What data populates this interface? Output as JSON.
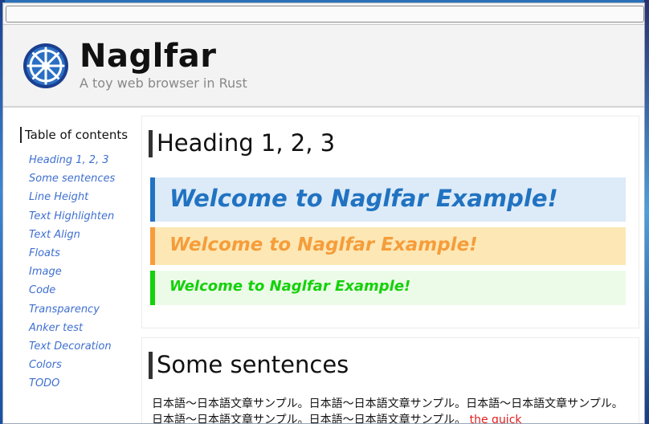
{
  "browser": {
    "url": ""
  },
  "header": {
    "title": "Naglfar",
    "subtitle": "A toy web browser in Rust"
  },
  "sidebar": {
    "title": "Table of contents",
    "items": [
      {
        "label": "Heading 1, 2, 3"
      },
      {
        "label": "Some sentences"
      },
      {
        "label": "Line Height"
      },
      {
        "label": "Text Highlighten"
      },
      {
        "label": "Text Align"
      },
      {
        "label": "Floats"
      },
      {
        "label": "Image"
      },
      {
        "label": "Code"
      },
      {
        "label": "Transparency"
      },
      {
        "label": "Anker test"
      },
      {
        "label": "Text Decoration"
      },
      {
        "label": "Colors"
      },
      {
        "label": "TODO"
      }
    ]
  },
  "main": {
    "section1": {
      "heading": "Heading 1, 2, 3",
      "banners": [
        {
          "text": "Welcome to Naglfar Example!",
          "color": "#2173c2"
        },
        {
          "text": "Welcome to Naglfar Example!",
          "color": "#f59d3b"
        },
        {
          "text": "Welcome to Naglfar Example!",
          "color": "#14d10a"
        }
      ]
    },
    "section2": {
      "heading": "Some sentences",
      "paragraph": "日本語〜日本語文章サンプル。日本語〜日本語文章サンプル。日本語〜日本語文章サンプル。日本語〜日本語文章サンプル。日本語〜日本語文章サンプル。",
      "red_text": "the quick"
    }
  },
  "colors": {
    "accent_blue": "#2173c2",
    "accent_orange": "#f59d3b",
    "accent_green": "#14d10a",
    "link": "#3f6fd0"
  }
}
